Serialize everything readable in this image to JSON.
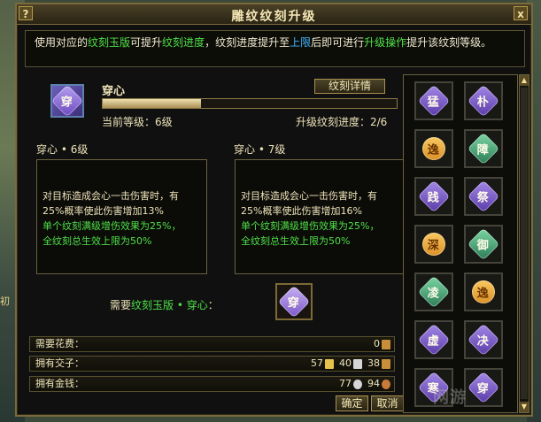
{
  "window": {
    "title": "雕纹纹刻升级",
    "help": "?",
    "close": "x"
  },
  "intro": {
    "p1": "使用对应的",
    "p2": "纹刻玉版",
    "p3": "可提升",
    "p4": "纹刻进度",
    "p5": "，纹刻进度提升至",
    "p6": "上限",
    "p7": "后即可进行",
    "p8": "升级操作",
    "p9": "提升该纹刻等级。"
  },
  "skill": {
    "name": "穿心",
    "icon_char": "穿",
    "detail_button": "纹刻详情",
    "current_level": "当前等级：6级",
    "upgrade_progress": "升级纹刻进度：2/6",
    "progress_fraction": 0.333
  },
  "current": {
    "title": "穿心 • 6级",
    "line1": "对目标造成会心一击伤害时，有",
    "line2": "25%概率使此伤害增加13%",
    "line3": "单个纹刻满级增伤效果为25%，",
    "line4": "全纹刻总生效上限为50%"
  },
  "next": {
    "title": "穿心 • 7级",
    "line1": "对目标造成会心一击伤害时，有",
    "line2": "25%概率使此伤害增加16%",
    "line3": "单个纹刻满级增伤效果为25%，",
    "line4": "全纹刻总生效上限为50%"
  },
  "need": {
    "prefix": "需要",
    "item": "纹刻玉版 • 穿心",
    "suffix": "："
  },
  "rows": {
    "cost_label": "需要花费：",
    "cost_value": "0",
    "ingot_label": "拥有交子：",
    "ingot_gold": "57",
    "ingot_silver": "40",
    "ingot_copper": "38",
    "money_label": "拥有金钱：",
    "money_silver": "77",
    "money_copper": "94"
  },
  "buttons": {
    "ok": "确定",
    "cancel": "取消"
  },
  "grid": {
    "cells": [
      {
        "char": "猛",
        "color": "purple"
      },
      {
        "char": "朴",
        "color": "purple"
      },
      {
        "char": "逸",
        "color": "orange"
      },
      {
        "char": "障",
        "color": "green-t"
      },
      {
        "char": "践",
        "color": "purple"
      },
      {
        "char": "祭",
        "color": "purple"
      },
      {
        "char": "深",
        "color": "orange"
      },
      {
        "char": "御",
        "color": "green-t"
      },
      {
        "char": "凌",
        "color": "green-t"
      },
      {
        "char": "逸",
        "color": "orange"
      },
      {
        "char": "虚",
        "color": "purple"
      },
      {
        "char": "决",
        "color": "purple"
      },
      {
        "char": "寒",
        "color": "purple"
      },
      {
        "char": "穿",
        "color": "purple"
      }
    ]
  },
  "backdrop": {
    "left_label": "初"
  },
  "watermark": "网游"
}
